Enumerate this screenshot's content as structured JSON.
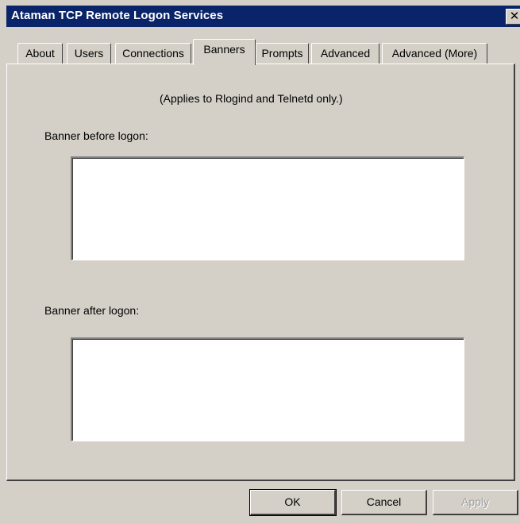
{
  "window": {
    "title": "Ataman TCP Remote Logon Services",
    "close_glyph": "✕"
  },
  "tabs": [
    {
      "label": "About",
      "active": false
    },
    {
      "label": "Users",
      "active": false
    },
    {
      "label": "Connections",
      "active": false
    },
    {
      "label": "Banners",
      "active": true
    },
    {
      "label": "Prompts",
      "active": false
    },
    {
      "label": "Advanced",
      "active": false
    },
    {
      "label": "Advanced (More)",
      "active": false
    }
  ],
  "banners": {
    "note": "(Applies to Rlogind and Telnetd only.)",
    "before_label": "Banner before logon:",
    "before_value": "",
    "after_label": "Banner after logon:",
    "after_value": ""
  },
  "buttons": {
    "ok": "OK",
    "cancel": "Cancel",
    "apply": "Apply"
  }
}
